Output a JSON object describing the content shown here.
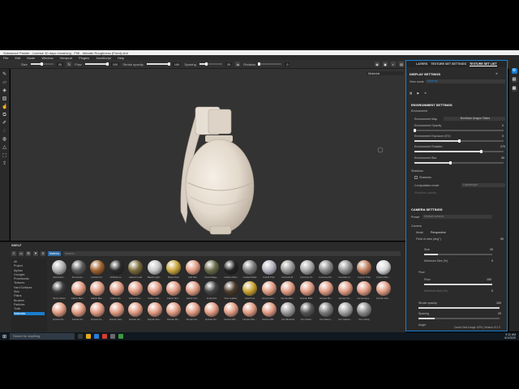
{
  "window": {
    "title": "Substance Painter - License 30 days remaining - FMI - Metallic Roughness (Fixed).sbd"
  },
  "menu": [
    "File",
    "Edit",
    "Mode",
    "Window",
    "Viewport",
    "Plugins",
    "JavaScript",
    "Help"
  ],
  "toolbar": {
    "size_label": "Size",
    "size_value": "20",
    "flow_label": "Flow",
    "flow_value": "100",
    "stroke_opacity_label": "Stroke opacity",
    "stroke_opacity_value": "100",
    "spacing_label": "Spacing",
    "spacing_value": "20",
    "rotation_label": "Rotation",
    "rotation_value": "0",
    "size_fill": 0.5,
    "flow_fill": 1.0,
    "stroke_opacity_fill": 1.0,
    "spacing_fill": 0.3,
    "rotation_fill": 0.0
  },
  "viewport": {
    "mode_dropdown": "Material"
  },
  "tabs": [
    "LAYERS",
    "TEXTURE SET SETTINGS",
    "TEXTURE SET LIST"
  ],
  "display_settings": {
    "title": "DISPLAY SETTINGS",
    "view_mode_label": "View mode",
    "view_mode_value": "Material",
    "environment_settings_title": "ENVIRONMENT SETTINGS",
    "environment_label": "Environment",
    "environment_map_label": "Environment Map",
    "environment_map_value": "Bonifacio Aragon Stairs",
    "env_opacity_label": "Environment Opacity",
    "env_opacity_value": "0",
    "env_exposure_label": "Environment Exposure (EV)",
    "env_exposure_value": "0",
    "env_rotation_label": "Environment Rotation",
    "env_rotation_value": "270",
    "env_blur_label": "Environment Blur",
    "env_blur_value": "30",
    "env_opacity_fill": 0.0,
    "env_exposure_fill": 0.5,
    "env_rotation_fill": 0.75,
    "env_blur_fill": 0.4,
    "shadows_label": "Shadows",
    "shadows_check_label": "Shadows",
    "computation_mode_label": "Computation mode",
    "computation_mode_value": "Lightweight",
    "shadows_opacity_label": "Shadows opacity",
    "camera_settings_title": "CAMERA SETTINGS",
    "preset_label": "Preset",
    "preset_value": "Default camera",
    "camera_label": "Camera",
    "mode_label": "Mode",
    "mode_value": "Perspective",
    "fov_label": "Field of view (deg°)",
    "fov_value": "90"
  },
  "brush_panel": {
    "size_label": "Size",
    "size_value": "20",
    "min_size_label": "Minimum Size (%)",
    "min_size_value": "0",
    "flow_label": "Flow",
    "flow_sub_label": "Flow",
    "flow_value": "100",
    "min_flow_label": "Minimum flow (%)",
    "min_flow_value": "0",
    "stroke_opacity_label": "Stroke opacity",
    "stroke_opacity_value": "100",
    "spacing_label": "Spacing",
    "spacing_value": "20",
    "angle_label": "Angle"
  },
  "shelf": {
    "title": "SHELF",
    "search_placeholder": "Search...",
    "filter_chip": "Materia...",
    "tree": [
      "All",
      "Project",
      "Alphas",
      "Grunges",
      "Procedurals",
      "Textures",
      "Hard Surfaces",
      "Skin",
      "Filters",
      "Brushes",
      "Particles",
      "Tools",
      "Materials"
    ],
    "selected": "Materials",
    "materials": [
      {
        "name": "Aluminium...",
        "color": "#b0b0b0"
      },
      {
        "name": "Aluminium...",
        "color": "#5a5a5a"
      },
      {
        "name": "Ambient Fi...",
        "color": "#a0622e"
      },
      {
        "name": "Artificial Le...",
        "color": "#2a2a2a"
      },
      {
        "name": "Autumn Leaf",
        "color": "#7a6a3a"
      },
      {
        "name": "Baked Light...",
        "color": "#c8c8c8"
      },
      {
        "name": "Brass Pure",
        "color": "#c9a53a"
      },
      {
        "name": "Calf Skin",
        "color": "#e09a82"
      },
      {
        "name": "Camouflage...",
        "color": "#6a6a4a"
      },
      {
        "name": "Carbon Fiber",
        "color": "#222222"
      },
      {
        "name": "Coated Metal",
        "color": "#7d7d7d"
      },
      {
        "name": "Cobalt Pure",
        "color": "#b5b5c0"
      },
      {
        "name": "Concrete B...",
        "color": "#9a9a9a"
      },
      {
        "name": "Concrete Cl...",
        "color": "#a8a8a8"
      },
      {
        "name": "Concrete Dir...",
        "color": "#8a8a8a"
      },
      {
        "name": "Concrete S...",
        "color": "#909090"
      },
      {
        "name": "Copper Pure",
        "color": "#c08060"
      },
      {
        "name": "Cotton Fibe...",
        "color": "#d8d8d8"
      },
      {
        "name": "Denim Rivet",
        "color": "#3a3a3a"
      },
      {
        "name": "Fabric Bam...",
        "color": "#e09a82"
      },
      {
        "name": "Fabric Bas...",
        "color": "#e09a82"
      },
      {
        "name": "Fabric Kn...",
        "color": "#e09a82"
      },
      {
        "name": "Fabric Rou...",
        "color": "#e09a82"
      },
      {
        "name": "Fabric Soft...",
        "color": "#e09a82"
      },
      {
        "name": "Fabric Suit...",
        "color": "#e09a82"
      },
      {
        "name": "Fabric Sof...",
        "color": "#e09a82"
      },
      {
        "name": "Footprints",
        "color": "#444444"
      },
      {
        "name": "Fine Leather",
        "color": "#4a3a2a"
      },
      {
        "name": "Gold Pure",
        "color": "#c9a030"
      },
      {
        "name": "Ground Gra...",
        "color": "#e09a82"
      },
      {
        "name": "Human Bac...",
        "color": "#e09a82"
      },
      {
        "name": "Human Bell...",
        "color": "#e09a82"
      },
      {
        "name": "Human Bu...",
        "color": "#e09a82"
      },
      {
        "name": "Human Ch...",
        "color": "#e09a82"
      },
      {
        "name": "Human Eye...",
        "color": "#e09a82"
      },
      {
        "name": "Human Fac...",
        "color": "#e09a82"
      },
      {
        "name": "Human Fe...",
        "color": "#e09a82"
      },
      {
        "name": "Human Fo...",
        "color": "#e09a82"
      },
      {
        "name": "Human Fo...",
        "color": "#e09a82"
      },
      {
        "name": "Human Hea...",
        "color": "#e09a82"
      },
      {
        "name": "Human He...",
        "color": "#e09a82"
      },
      {
        "name": "Human Kne...",
        "color": "#e09a82"
      },
      {
        "name": "Human Mo...",
        "color": "#e09a82"
      },
      {
        "name": "Human Ne...",
        "color": "#e09a82"
      },
      {
        "name": "Human No...",
        "color": "#e09a82"
      },
      {
        "name": "Human Wri...",
        "color": "#e09a82"
      },
      {
        "name": "Human Sho...",
        "color": "#e09a82"
      },
      {
        "name": "Human Wri...",
        "color": "#e09a82"
      },
      {
        "name": "Iron Brushed",
        "color": "#9a9a9a"
      },
      {
        "name": "Iron Chain...",
        "color": "#555555"
      },
      {
        "name": "Iron Diamo...",
        "color": "#7a7a7a"
      },
      {
        "name": "Iron Galvan...",
        "color": "#a0a0a0"
      },
      {
        "name": "Iron Grainy",
        "color": "#8a8a8a"
      }
    ]
  },
  "status_bar": {
    "text": "Cache Disk Usage: 80% | Version: 8.2.3"
  },
  "taskbar": {
    "search_placeholder": "Search for anything",
    "clock": "9:11 AM",
    "date": "6/1/2020"
  },
  "colors": {
    "accent": "#1a7ecf",
    "panel": "#2b2b2b",
    "viewport": "#333333",
    "grenade": "#e6ded4"
  }
}
